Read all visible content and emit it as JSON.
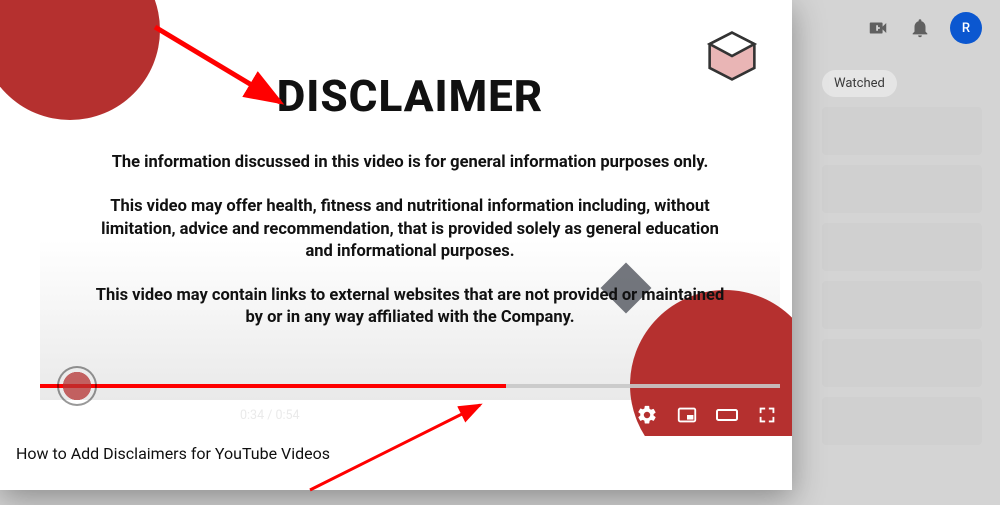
{
  "header": {
    "avatar_initial": "R"
  },
  "recommendations": {
    "filter_chip": "Watched"
  },
  "video": {
    "title": "How to Add Disclaimers for YouTube Videos",
    "slide": {
      "heading": "DISCLAIMER",
      "p1": "The information discussed in this video is for general information purposes only.",
      "p2": "This video may offer health, fitness and nutritional information including, without limitation, advice and recommendation, that is provided solely as general education and informational purposes.",
      "p3": "This video may contain links to external websites that are not provided or maintained by or in any way affiliated with the Company."
    },
    "player": {
      "current_time": "0:34",
      "duration": "0:54",
      "progress_percent": 63,
      "thumb_left_percent": 5
    }
  },
  "colors": {
    "accent_red": "#ff0000",
    "brand_red": "#b5302f"
  }
}
